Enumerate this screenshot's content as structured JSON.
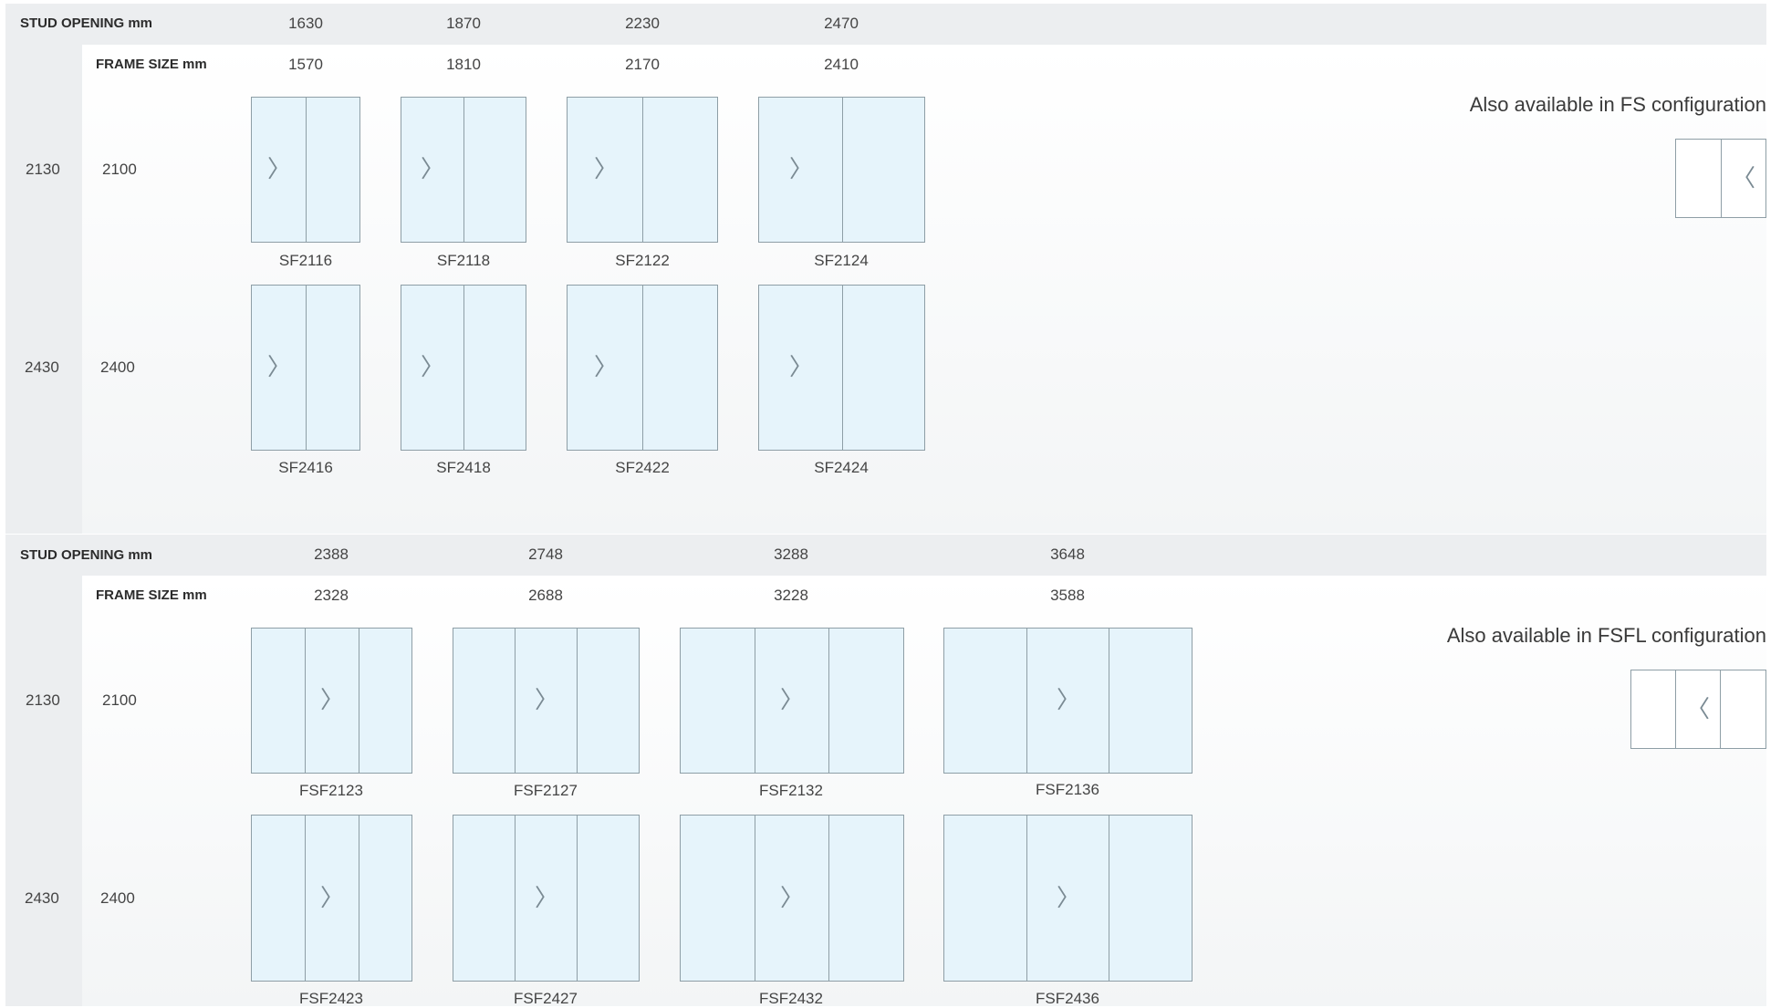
{
  "header_labels": {
    "stud_opening": "STUD OPENING mm",
    "frame_size": "FRAME SIZE mm"
  },
  "sections": [
    {
      "name": "sf",
      "stud_openings": [
        "1630",
        "1870",
        "2230",
        "2470"
      ],
      "frame_sizes": [
        "1570",
        "1810",
        "2170",
        "2410"
      ],
      "rows": [
        {
          "stud": "2130",
          "frame": "2100",
          "codes": [
            "SF2116",
            "SF2118",
            "SF2122",
            "SF2124"
          ]
        },
        {
          "stud": "2430",
          "frame": "2400",
          "codes": [
            "SF2416",
            "SF2418",
            "SF2422",
            "SF2424"
          ]
        }
      ],
      "note": "Also available in FS configuration",
      "door_panels": 2,
      "arrow": "chevron-right",
      "alt_arrow": "chevron-left"
    },
    {
      "name": "fsf",
      "stud_openings": [
        "2388",
        "2748",
        "3288",
        "3648"
      ],
      "frame_sizes": [
        "2328",
        "2688",
        "3228",
        "3588"
      ],
      "rows": [
        {
          "stud": "2130",
          "frame": "2100",
          "codes": [
            "FSF2123",
            "FSF2127",
            "FSF2132",
            "FSF2136"
          ]
        },
        {
          "stud": "2430",
          "frame": "2400",
          "codes": [
            "FSF2423",
            "FSF2427",
            "FSF2432",
            "FSF2436"
          ]
        }
      ],
      "note": "Also available in FSFL configuration",
      "door_panels": 3,
      "arrow": "chevron-right",
      "alt_arrow": "chevron-left"
    }
  ],
  "colors": {
    "glass": "#e6f4fb",
    "frame": "#8e9ea6",
    "header_bg": "#eceef0"
  }
}
